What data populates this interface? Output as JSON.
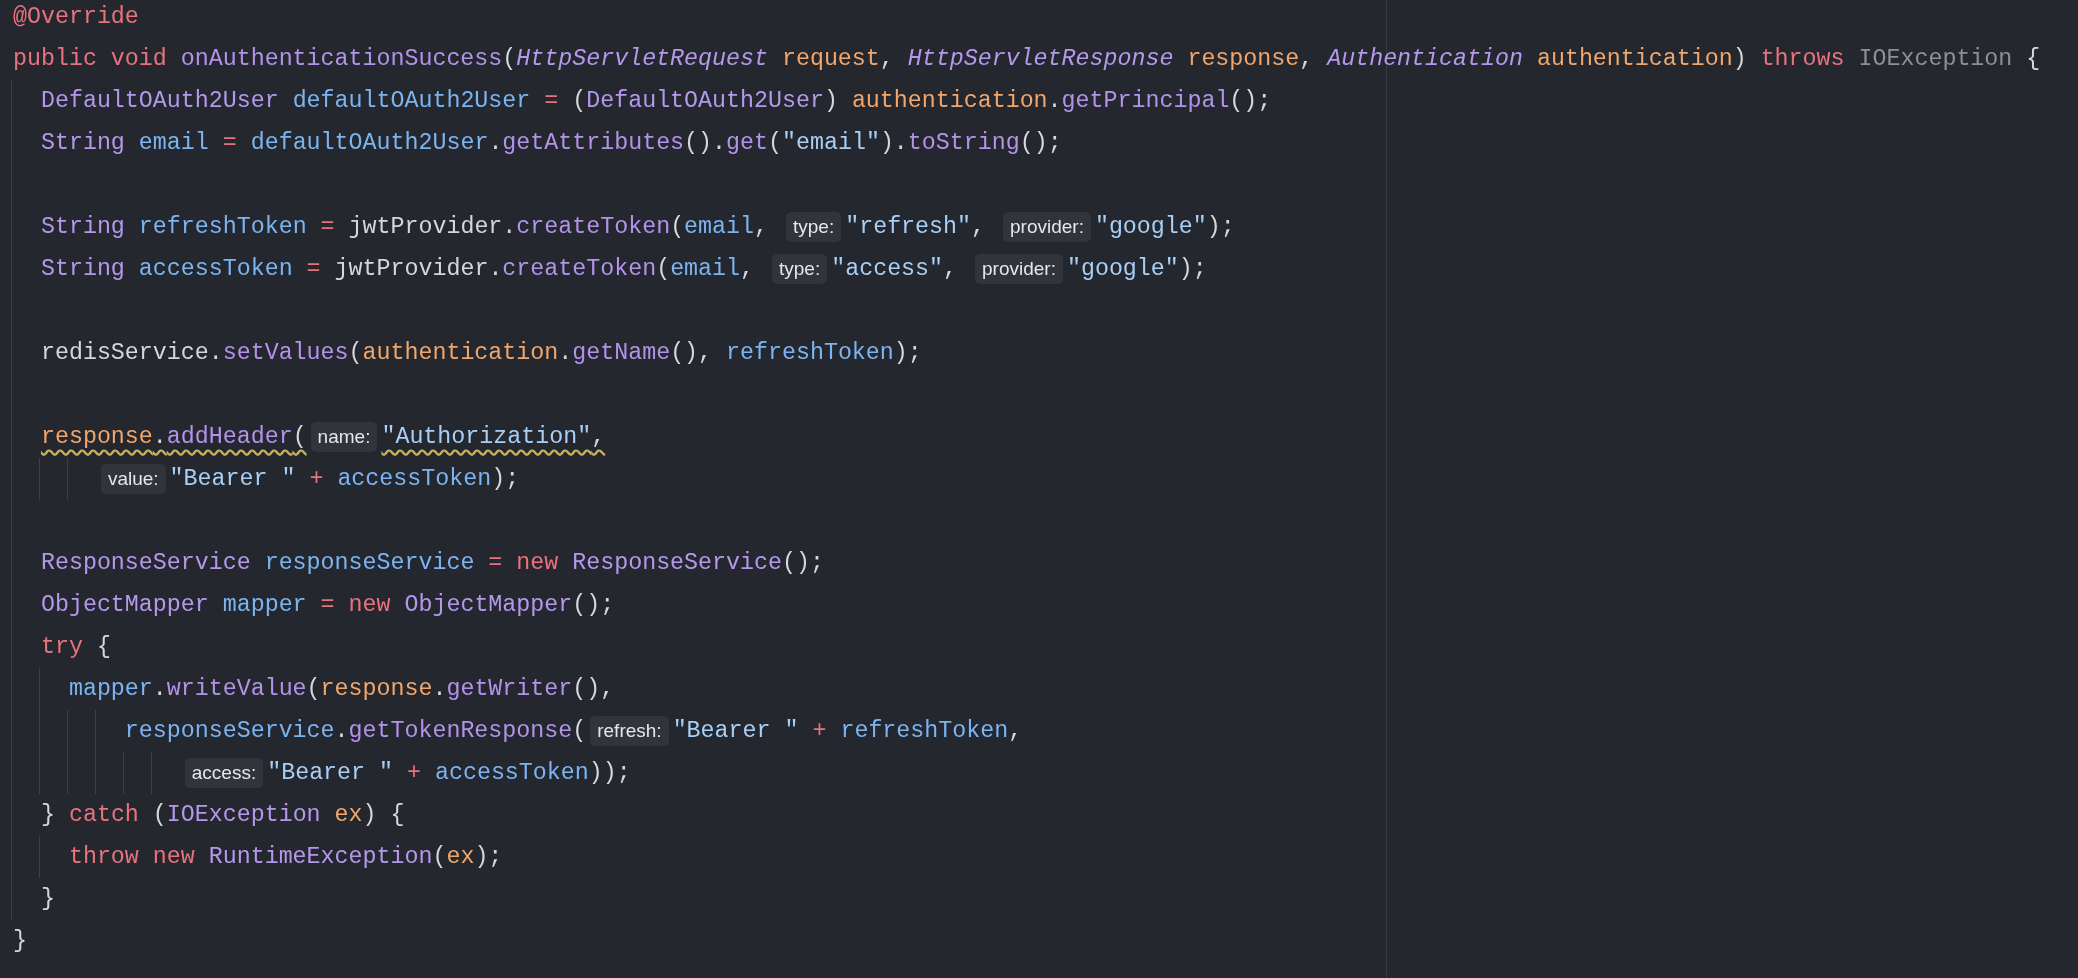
{
  "editor": {
    "lines": [
      {
        "kind": "code",
        "warning": false,
        "tokens": [
          {
            "kind": "ann",
            "text": "@Override"
          }
        ]
      },
      {
        "kind": "code",
        "warning": false,
        "tokens": [
          {
            "kind": "kw",
            "text": "public void "
          },
          {
            "kind": "fn",
            "text": "onAuthenticationSuccess"
          },
          {
            "kind": "txt",
            "text": "("
          },
          {
            "kind": "itype",
            "text": "HttpServletRequest "
          },
          {
            "kind": "param",
            "text": "request"
          },
          {
            "kind": "txt",
            "text": ", "
          },
          {
            "kind": "itype",
            "text": "HttpServletResponse "
          },
          {
            "kind": "param",
            "text": "response"
          },
          {
            "kind": "txt",
            "text": ", "
          },
          {
            "kind": "itype",
            "text": "Authentication "
          },
          {
            "kind": "param",
            "text": "authentication"
          },
          {
            "kind": "txt",
            "text": ") "
          },
          {
            "kind": "kw",
            "text": "throws "
          },
          {
            "kind": "dim",
            "text": "IOException "
          },
          {
            "kind": "txt",
            "text": "{"
          }
        ]
      },
      {
        "kind": "code",
        "warning": false,
        "tokens": [
          {
            "kind": "type",
            "text": "  DefaultOAuth2User "
          },
          {
            "kind": "var",
            "text": "defaultOAuth2User"
          },
          {
            "kind": "op",
            "text": " = "
          },
          {
            "kind": "txt",
            "text": "("
          },
          {
            "kind": "type",
            "text": "DefaultOAuth2User"
          },
          {
            "kind": "txt",
            "text": ") "
          },
          {
            "kind": "param",
            "text": "authentication"
          },
          {
            "kind": "txt",
            "text": "."
          },
          {
            "kind": "fn",
            "text": "getPrincipal"
          },
          {
            "kind": "txt",
            "text": "();"
          }
        ]
      },
      {
        "kind": "code",
        "warning": false,
        "tokens": [
          {
            "kind": "type",
            "text": "  String "
          },
          {
            "kind": "var",
            "text": "email"
          },
          {
            "kind": "op",
            "text": " = "
          },
          {
            "kind": "var",
            "text": "defaultOAuth2User"
          },
          {
            "kind": "txt",
            "text": "."
          },
          {
            "kind": "fn",
            "text": "getAttributes"
          },
          {
            "kind": "txt",
            "text": "()."
          },
          {
            "kind": "fn",
            "text": "get"
          },
          {
            "kind": "txt",
            "text": "("
          },
          {
            "kind": "str",
            "text": "\"email\""
          },
          {
            "kind": "txt",
            "text": ")."
          },
          {
            "kind": "fn",
            "text": "toString"
          },
          {
            "kind": "txt",
            "text": "();"
          }
        ]
      },
      {
        "kind": "blank"
      },
      {
        "kind": "code",
        "warning": false,
        "tokens": [
          {
            "kind": "type",
            "text": "  String "
          },
          {
            "kind": "var",
            "text": "refreshToken"
          },
          {
            "kind": "op",
            "text": " = "
          },
          {
            "kind": "txt",
            "text": "jwtProvider."
          },
          {
            "kind": "fn",
            "text": "createToken"
          },
          {
            "kind": "txt",
            "text": "("
          },
          {
            "kind": "var",
            "text": "email"
          },
          {
            "kind": "txt",
            "text": ", "
          },
          {
            "kind": "hint",
            "text": "type:"
          },
          {
            "kind": "str",
            "text": "\"refresh\""
          },
          {
            "kind": "txt",
            "text": ", "
          },
          {
            "kind": "hint",
            "text": "provider:"
          },
          {
            "kind": "str",
            "text": "\"google\""
          },
          {
            "kind": "txt",
            "text": ");"
          }
        ]
      },
      {
        "kind": "code",
        "warning": false,
        "tokens": [
          {
            "kind": "type",
            "text": "  String "
          },
          {
            "kind": "var",
            "text": "accessToken"
          },
          {
            "kind": "op",
            "text": " = "
          },
          {
            "kind": "txt",
            "text": "jwtProvider."
          },
          {
            "kind": "fn",
            "text": "createToken"
          },
          {
            "kind": "txt",
            "text": "("
          },
          {
            "kind": "var",
            "text": "email"
          },
          {
            "kind": "txt",
            "text": ", "
          },
          {
            "kind": "hint",
            "text": "type:"
          },
          {
            "kind": "str",
            "text": "\"access\""
          },
          {
            "kind": "txt",
            "text": ", "
          },
          {
            "kind": "hint",
            "text": "provider:"
          },
          {
            "kind": "str",
            "text": "\"google\""
          },
          {
            "kind": "txt",
            "text": ");"
          }
        ]
      },
      {
        "kind": "blank"
      },
      {
        "kind": "code",
        "warning": false,
        "tokens": [
          {
            "kind": "txt",
            "text": "  redisService."
          },
          {
            "kind": "fn",
            "text": "setValues"
          },
          {
            "kind": "txt",
            "text": "("
          },
          {
            "kind": "param",
            "text": "authentication"
          },
          {
            "kind": "txt",
            "text": "."
          },
          {
            "kind": "fn",
            "text": "getName"
          },
          {
            "kind": "txt",
            "text": "(), "
          },
          {
            "kind": "var",
            "text": "refreshToken"
          },
          {
            "kind": "txt",
            "text": ");"
          }
        ]
      },
      {
        "kind": "blank"
      },
      {
        "kind": "code",
        "warning": true,
        "tokens": [
          {
            "kind": "param",
            "text": "  response"
          },
          {
            "kind": "txt",
            "text": "."
          },
          {
            "kind": "fn",
            "text": "addHeader"
          },
          {
            "kind": "txt",
            "text": "("
          },
          {
            "kind": "hint",
            "text": "name:"
          },
          {
            "kind": "str",
            "text": "\"Authorization\""
          },
          {
            "kind": "txt",
            "text": ","
          }
        ]
      },
      {
        "kind": "code",
        "warning": false,
        "tokens": [
          {
            "kind": "hint",
            "text": "      value:"
          },
          {
            "kind": "str",
            "text": "\"Bearer \""
          },
          {
            "kind": "op",
            "text": " + "
          },
          {
            "kind": "var",
            "text": "accessToken"
          },
          {
            "kind": "txt",
            "text": ");"
          }
        ]
      },
      {
        "kind": "blank"
      },
      {
        "kind": "code",
        "warning": false,
        "tokens": [
          {
            "kind": "type",
            "text": "  ResponseService "
          },
          {
            "kind": "var",
            "text": "responseService"
          },
          {
            "kind": "op",
            "text": " = "
          },
          {
            "kind": "kw",
            "text": "new "
          },
          {
            "kind": "type",
            "text": "ResponseService"
          },
          {
            "kind": "txt",
            "text": "();"
          }
        ]
      },
      {
        "kind": "code",
        "warning": false,
        "tokens": [
          {
            "kind": "type",
            "text": "  ObjectMapper "
          },
          {
            "kind": "var",
            "text": "mapper"
          },
          {
            "kind": "op",
            "text": " = "
          },
          {
            "kind": "kw",
            "text": "new "
          },
          {
            "kind": "type",
            "text": "ObjectMapper"
          },
          {
            "kind": "txt",
            "text": "();"
          }
        ]
      },
      {
        "kind": "code",
        "warning": false,
        "tokens": [
          {
            "kind": "kw",
            "text": "  try "
          },
          {
            "kind": "txt",
            "text": "{"
          }
        ]
      },
      {
        "kind": "code",
        "warning": false,
        "tokens": [
          {
            "kind": "var",
            "text": "    mapper"
          },
          {
            "kind": "txt",
            "text": "."
          },
          {
            "kind": "fn",
            "text": "writeValue"
          },
          {
            "kind": "txt",
            "text": "("
          },
          {
            "kind": "param",
            "text": "response"
          },
          {
            "kind": "txt",
            "text": "."
          },
          {
            "kind": "fn",
            "text": "getWriter"
          },
          {
            "kind": "txt",
            "text": "(),"
          }
        ]
      },
      {
        "kind": "code",
        "warning": false,
        "tokens": [
          {
            "kind": "var",
            "text": "        responseService"
          },
          {
            "kind": "txt",
            "text": "."
          },
          {
            "kind": "fn",
            "text": "getTokenResponse"
          },
          {
            "kind": "txt",
            "text": "("
          },
          {
            "kind": "hint",
            "text": "refresh:"
          },
          {
            "kind": "str",
            "text": "\"Bearer \""
          },
          {
            "kind": "op",
            "text": " + "
          },
          {
            "kind": "var",
            "text": "refreshToken"
          },
          {
            "kind": "txt",
            "text": ","
          }
        ]
      },
      {
        "kind": "code",
        "warning": false,
        "tokens": [
          {
            "kind": "hint",
            "text": "            access:"
          },
          {
            "kind": "str",
            "text": "\"Bearer \""
          },
          {
            "kind": "op",
            "text": " + "
          },
          {
            "kind": "var",
            "text": "accessToken"
          },
          {
            "kind": "txt",
            "text": "));"
          }
        ]
      },
      {
        "kind": "code",
        "warning": false,
        "tokens": [
          {
            "kind": "txt",
            "text": "  } "
          },
          {
            "kind": "kw",
            "text": "catch "
          },
          {
            "kind": "txt",
            "text": "("
          },
          {
            "kind": "type",
            "text": "IOException "
          },
          {
            "kind": "param",
            "text": "ex"
          },
          {
            "kind": "txt",
            "text": ") {"
          }
        ]
      },
      {
        "kind": "code",
        "warning": false,
        "tokens": [
          {
            "kind": "kw",
            "text": "    throw new "
          },
          {
            "kind": "type",
            "text": "RuntimeException"
          },
          {
            "kind": "txt",
            "text": "("
          },
          {
            "kind": "param",
            "text": "ex"
          },
          {
            "kind": "txt",
            "text": ");"
          }
        ]
      },
      {
        "kind": "code",
        "warning": false,
        "tokens": [
          {
            "kind": "txt",
            "text": "  }"
          }
        ]
      },
      {
        "kind": "code",
        "warning": false,
        "tokens": [
          {
            "kind": "txt",
            "text": "}"
          }
        ]
      }
    ]
  }
}
